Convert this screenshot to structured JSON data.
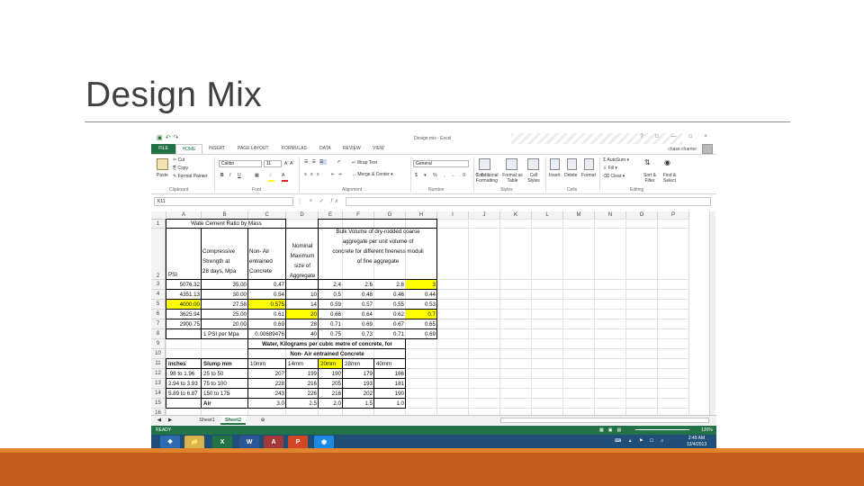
{
  "slide": {
    "title": "Design Mix"
  },
  "excel": {
    "window_title": "Design mix - Excel",
    "user": "chase charrier",
    "tabs": [
      "FILE",
      "HOME",
      "INSERT",
      "PAGE LAYOUT",
      "FORMULAS",
      "DATA",
      "REVIEW",
      "VIEW"
    ],
    "ribbon": {
      "cut": "Cut",
      "copy": "Copy",
      "paste": "Paste",
      "format_painter": "Format Painter",
      "font_name": "Calibri",
      "font_size": "11",
      "wrap_text": "Wrap Text",
      "merge_center": "Merge & Center",
      "number_format": "General",
      "conditional_formatting": "Conditional Formatting",
      "format_as_table": "Format as Table",
      "cell_styles": "Cell Styles",
      "insert": "Insert",
      "delete": "Delete",
      "format": "Format",
      "autosum": "AutoSum",
      "fill": "Fill",
      "clear": "Clear",
      "sort_filter": "Sort & Filter",
      "find_select": "Find & Select",
      "groups": [
        "Clipboard",
        "Font",
        "Alignment",
        "Number",
        "Styles",
        "Cells",
        "Editing"
      ]
    },
    "name_box": "K11",
    "columns": [
      "A",
      "B",
      "C",
      "D",
      "E",
      "F",
      "G",
      "H",
      "I",
      "J",
      "K",
      "L",
      "M",
      "N",
      "O",
      "P"
    ],
    "rows": [
      "1",
      "2",
      "3",
      "4",
      "5",
      "6",
      "7",
      "8",
      "9",
      "10",
      "11",
      "12",
      "13",
      "14",
      "15",
      "16"
    ],
    "cells": {
      "r1": "Wate Cement Ratio by Mass",
      "b2": "Compressive Strength at 28 days, Mpa",
      "b2_lines": [
        "Compressive",
        "Strength at",
        "28 days, Mpa"
      ],
      "c2_lines": [
        "Non- Air",
        "entrained",
        "Concrete"
      ],
      "d2_lines": [
        "Nominal",
        "Maximum",
        "size of",
        "Aggregate"
      ],
      "e_header_lines": [
        "Bulk Volume of dry-rodded coarse",
        "aggregate per unit volume of",
        "concrete for different fineness moduli",
        "of fine aggregate"
      ],
      "a2": "PSI",
      "data": [
        {
          "a": "5076.32",
          "b": "35.00",
          "c": "0.47",
          "d": "",
          "e": "2.4",
          "f": "2.6",
          "g": "2.8",
          "h": "3"
        },
        {
          "a": "4351.13",
          "b": "30.00",
          "c": "0.54",
          "d": "10",
          "e": "0.5",
          "f": "0.48",
          "g": "0.46",
          "h": "0.44"
        },
        {
          "a": "4000.00",
          "b": "27.58",
          "c": "0.575",
          "d": "14",
          "e": "0.59",
          "f": "0.57",
          "g": "0.55",
          "h": "0.53"
        },
        {
          "a": "3625.94",
          "b": "25.00",
          "c": "0.61",
          "d": "20",
          "e": "0.66",
          "f": "0.64",
          "g": "0.62",
          "h": "0.7"
        },
        {
          "a": "2900.75",
          "b": "20.00",
          "c": "0.69",
          "d": "28",
          "e": "0.71",
          "f": "0.69",
          "g": "0.67",
          "h": "0.65"
        },
        {
          "a": "",
          "b": "1 PSI per Mpa",
          "c": "0.00689476",
          "d": "40",
          "e": "0.75",
          "f": "0.73",
          "g": "0.71",
          "h": "0.69"
        }
      ],
      "r9": "Water, Kilograms per cubic metre of concrete, for",
      "r10": "Non- Air entrained  Concrete",
      "r11": [
        "inches",
        "Slump mm",
        "10mm",
        "14mm",
        "20mm",
        "28mm",
        "40mm"
      ],
      "water": [
        {
          "a": ".98 to 1.96",
          "b": "25 to 50",
          "c": "207",
          "d": "199",
          "e": "190",
          "f": "179",
          "g": "166"
        },
        {
          "a": "2.94 to 3.93",
          "b": "75 to 100",
          "c": "228",
          "d": "216",
          "e": "205",
          "f": "193",
          "g": "181"
        },
        {
          "a": "5.89 to 6.87",
          "b": "150 to 175",
          "c": "243",
          "d": "226",
          "e": "216",
          "f": "202",
          "g": "190"
        },
        {
          "a": "",
          "b": "Air",
          "c": "3.0",
          "d": "2.5",
          "e": "2.0",
          "f": "1.5",
          "g": "1.0"
        }
      ]
    },
    "sheets": [
      "Sheet1",
      "Sheet2"
    ],
    "status": "READY",
    "zoom": "120%",
    "clock_time": "2:49 AM",
    "clock_date": "12/4/2013",
    "colors": {
      "excel_green": "#217346",
      "highlight": "#ffff00",
      "taskbar": "#1f4e78",
      "band": "#c55a1d"
    }
  }
}
